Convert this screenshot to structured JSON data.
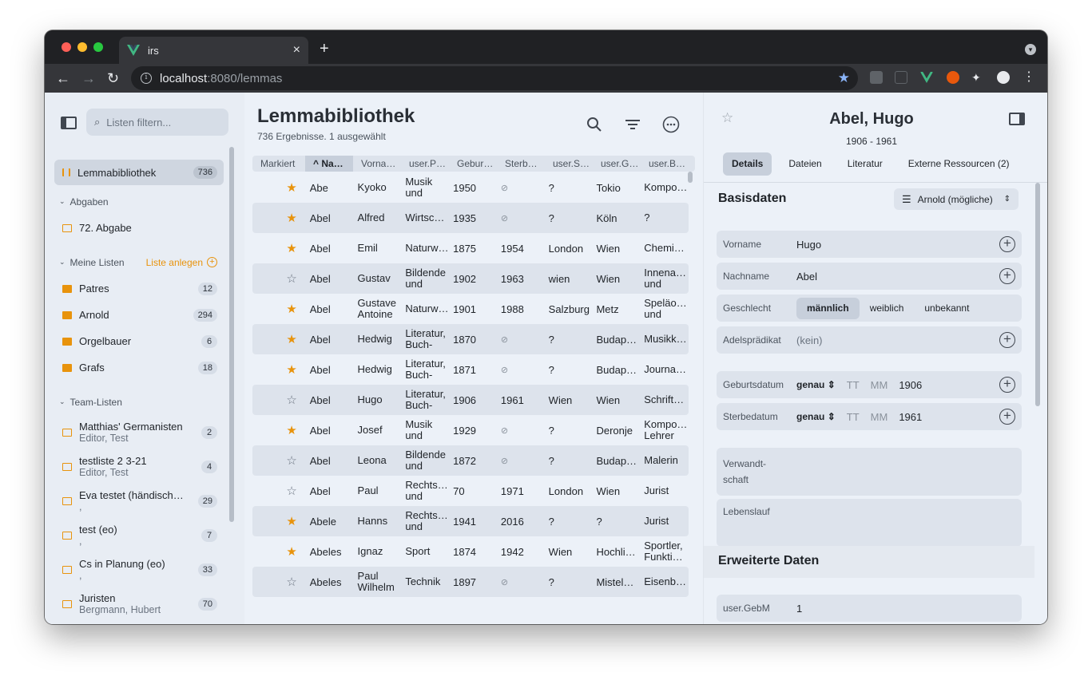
{
  "browser": {
    "tab_title": "irs",
    "url_host": "localhost",
    "url_rest": ":8080/lemmas",
    "traffic_colors": [
      "#ff5f57",
      "#febc2e",
      "#28c840"
    ]
  },
  "sidebar": {
    "filter_placeholder": "Listen filtern...",
    "library": {
      "label": "Lemmabibliothek",
      "count": "736"
    },
    "sections": {
      "abgaben": "Abgaben",
      "meine_listen": "Meine Listen",
      "create_list": "Liste anlegen",
      "team_listen": "Team-Listen"
    },
    "abgabe_item": "72. Abgabe",
    "my_lists": [
      {
        "label": "Patres",
        "count": "12"
      },
      {
        "label": "Arnold",
        "count": "294"
      },
      {
        "label": "Orgelbauer",
        "count": "6"
      },
      {
        "label": "Grafs",
        "count": "18"
      }
    ],
    "team_lists": [
      {
        "label": "Matthias' Germanisten",
        "sub": "Editor, Test",
        "count": "2"
      },
      {
        "label": "testliste 2 3-21",
        "sub": "Editor, Test",
        "count": "4"
      },
      {
        "label": "Eva testet (händisch…",
        "sub": ",",
        "count": "29"
      },
      {
        "label": "test (eo)",
        "sub": ",",
        "count": "7"
      },
      {
        "label": "Cs in Planung (eo)",
        "sub": ",",
        "count": "33"
      },
      {
        "label": "Juristen",
        "sub": "Bergmann, Hubert",
        "count": "70"
      }
    ]
  },
  "main": {
    "title": "Lemmabibliothek",
    "subtitle": "736 Ergebnisse. 1 ausgewählt",
    "columns": [
      "Markiert",
      "Na…",
      "Vorna…",
      "user.P…",
      "Gebur…",
      "Sterb…",
      "user.S…",
      "user.G…",
      "user.B…"
    ],
    "rows": [
      {
        "star": true,
        "name": "Abe",
        "first": "Kyoko",
        "prof": "Musik und",
        "born": "1950",
        "died": "⊘",
        "s": "?",
        "g": "Tokio",
        "b": "Kompo…"
      },
      {
        "star": true,
        "name": "Abel",
        "first": "Alfred",
        "prof": "Wirtsc…",
        "born": "1935",
        "died": "⊘",
        "s": "?",
        "g": "Köln",
        "b": "?"
      },
      {
        "star": true,
        "name": "Abel",
        "first": "Emil",
        "prof": "Naturw…",
        "born": "1875",
        "died": "1954",
        "s": "London",
        "g": "Wien",
        "b": "Chemi…"
      },
      {
        "star": false,
        "name": "Abel",
        "first": "Gustav",
        "prof": "Bildende und",
        "born": "1902",
        "died": "1963",
        "s": "wien",
        "g": "Wien",
        "b": "Innena… und"
      },
      {
        "star": true,
        "name": "Abel",
        "first": "Gustave Antoine",
        "prof": "Naturw…",
        "born": "1901",
        "died": "1988",
        "s": "Salzburg",
        "g": "Metz",
        "b": "Speläo… und"
      },
      {
        "star": true,
        "name": "Abel",
        "first": "Hedwig",
        "prof": "Literatur, Buch-",
        "born": "1870",
        "died": "⊘",
        "s": "?",
        "g": "Budap…",
        "b": "Musikk…"
      },
      {
        "star": true,
        "name": "Abel",
        "first": "Hedwig",
        "prof": "Literatur, Buch-",
        "born": "1871",
        "died": "⊘",
        "s": "?",
        "g": "Budap…",
        "b": "Journa…"
      },
      {
        "star": false,
        "name": "Abel",
        "first": "Hugo",
        "prof": "Literatur, Buch-",
        "born": "1906",
        "died": "1961",
        "s": "Wien",
        "g": "Wien",
        "b": "Schrift…"
      },
      {
        "star": true,
        "name": "Abel",
        "first": "Josef",
        "prof": "Musik und",
        "born": "1929",
        "died": "⊘",
        "s": "?",
        "g": "Deronje",
        "b": "Kompo… Lehrer"
      },
      {
        "star": false,
        "name": "Abel",
        "first": "Leona",
        "prof": "Bildende und",
        "born": "1872",
        "died": "⊘",
        "s": "?",
        "g": "Budap…",
        "b": "Malerin"
      },
      {
        "star": false,
        "name": "Abel",
        "first": "Paul",
        "prof": "Rechts… und",
        "born": "70",
        "died": "1971",
        "s": "London",
        "g": "Wien",
        "b": "Jurist"
      },
      {
        "star": true,
        "name": "Abele",
        "first": "Hanns",
        "prof": "Rechts… und",
        "born": "1941",
        "died": "2016",
        "s": "?",
        "g": "?",
        "b": "Jurist"
      },
      {
        "star": true,
        "name": "Abeles",
        "first": "Ignaz",
        "prof": "Sport",
        "born": "1874",
        "died": "1942",
        "s": "Wien",
        "g": "Hochli…",
        "b": "Sportler, Funkti…"
      },
      {
        "star": false,
        "name": "Abeles",
        "first": "Paul Wilhelm",
        "prof": "Technik",
        "born": "1897",
        "died": "⊘",
        "s": "?",
        "g": "Mistel…",
        "b": "Eisenb…"
      }
    ]
  },
  "detail": {
    "name": "Abel, Hugo",
    "dates": "1906 - 1961",
    "tabs": [
      "Details",
      "Dateien",
      "Literatur",
      "Externe Ressourcen (2)"
    ],
    "basis_title": "Basisdaten",
    "list_selector": "Arnold (mögliche)",
    "fields": {
      "vorname_label": "Vorname",
      "vorname": "Hugo",
      "nachname_label": "Nachname",
      "nachname": "Abel",
      "geschlecht_label": "Geschlecht",
      "gender_options": [
        "männlich",
        "weiblich",
        "unbekannt"
      ],
      "adel_label": "Adelsprädikat",
      "adel": "(kein)",
      "geburt_label": "Geburtsdatum",
      "geburt_precision": "genau",
      "geburt_tt": "TT",
      "geburt_mm": "MM",
      "geburt_year": "1906",
      "sterbe_label": "Sterbedatum",
      "sterbe_precision": "genau",
      "sterbe_tt": "TT",
      "sterbe_mm": "MM",
      "sterbe_year": "1961",
      "verwandt_label_1": "Verwandt-",
      "verwandt_label_2": "schaft",
      "lebenslauf_label": "Lebenslauf"
    },
    "erweitert_title": "Erweiterte Daten",
    "gebm_label": "user.GebM",
    "gebm_value": "1"
  }
}
